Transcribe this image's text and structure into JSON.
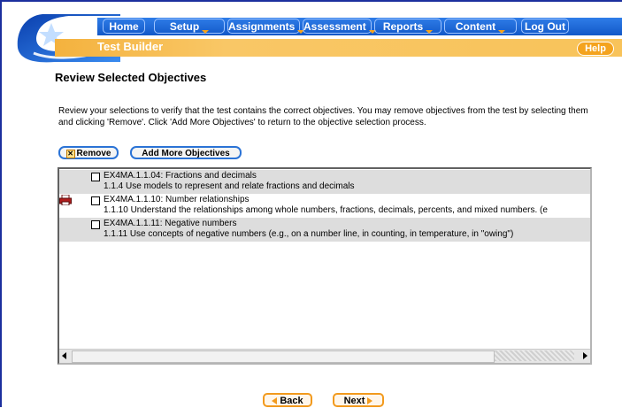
{
  "colors": {
    "brand_blue": "#1258c8",
    "accent_orange": "#f4a31e",
    "row_shade": "#dddddd"
  },
  "nav": {
    "items": [
      {
        "label": "Home"
      },
      {
        "label": "Setup"
      },
      {
        "label": "Assignments"
      },
      {
        "label": "Assessment"
      },
      {
        "label": "Reports"
      },
      {
        "label": "Content"
      },
      {
        "label": "Log Out"
      }
    ]
  },
  "subheader": {
    "title": "Test Builder",
    "help_label": "Help"
  },
  "page": {
    "title": "Review Selected Objectives",
    "intro": "Review your selections to verify that the test contains the correct objectives. You may remove objectives from the test by selecting them and clicking 'Remove'. Click 'Add More Objectives' to return to the objective selection process."
  },
  "actions": {
    "remove_label": "Remove",
    "add_more_label": "Add More Objectives"
  },
  "objectives": [
    {
      "code_title": "EX4MA.1.1.04: Fractions and decimals",
      "description": "1.1.4 Use models to represent and relate fractions and decimals",
      "checked": false,
      "printer_icon": false
    },
    {
      "code_title": "EX4MA.1.1.10: Number relationships",
      "description": "1.1.10 Understand the relationships among whole numbers, fractions, decimals, percents, and mixed numbers. (e",
      "checked": false,
      "printer_icon": true
    },
    {
      "code_title": "EX4MA.1.1.11: Negative numbers",
      "description": "1.1.11 Use concepts of negative numbers (e.g., on a number line, in counting, in temperature, in \"owing\")",
      "checked": false,
      "printer_icon": false
    }
  ],
  "footer": {
    "back_label": "Back",
    "next_label": "Next"
  }
}
